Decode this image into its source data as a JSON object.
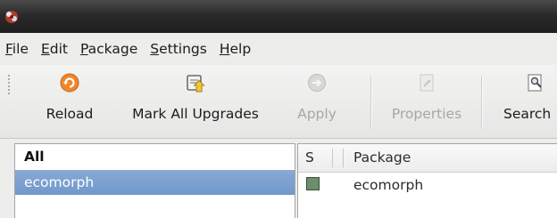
{
  "menubar": {
    "items": [
      {
        "mnemonic": "F",
        "rest": "ile"
      },
      {
        "mnemonic": "E",
        "rest": "dit"
      },
      {
        "mnemonic": "P",
        "rest": "ackage"
      },
      {
        "mnemonic": "S",
        "rest": "ettings"
      },
      {
        "mnemonic": "H",
        "rest": "elp"
      }
    ]
  },
  "toolbar": {
    "reload": {
      "label": "Reload",
      "icon": "reload-icon",
      "enabled": true
    },
    "mark_all_upgrades": {
      "label": "Mark All Upgrades",
      "icon": "mark-upgrades-icon",
      "enabled": true
    },
    "apply": {
      "label": "Apply",
      "icon": "apply-icon",
      "enabled": false
    },
    "properties": {
      "label": "Properties",
      "icon": "properties-icon",
      "enabled": false
    },
    "search": {
      "label": "Search",
      "icon": "search-icon",
      "enabled": true
    }
  },
  "filter_list": {
    "items": [
      {
        "label": "All",
        "bold": true,
        "selected": false
      },
      {
        "label": "ecomorph",
        "bold": false,
        "selected": true
      }
    ]
  },
  "package_list": {
    "columns": {
      "status": "S",
      "package": "Package"
    },
    "rows": [
      {
        "status": "installed",
        "package": "ecomorph"
      }
    ]
  },
  "colors": {
    "selection": "#7a9fd1",
    "status_installed": "#6a8f6a",
    "titlebar": "#2b2b2b"
  }
}
